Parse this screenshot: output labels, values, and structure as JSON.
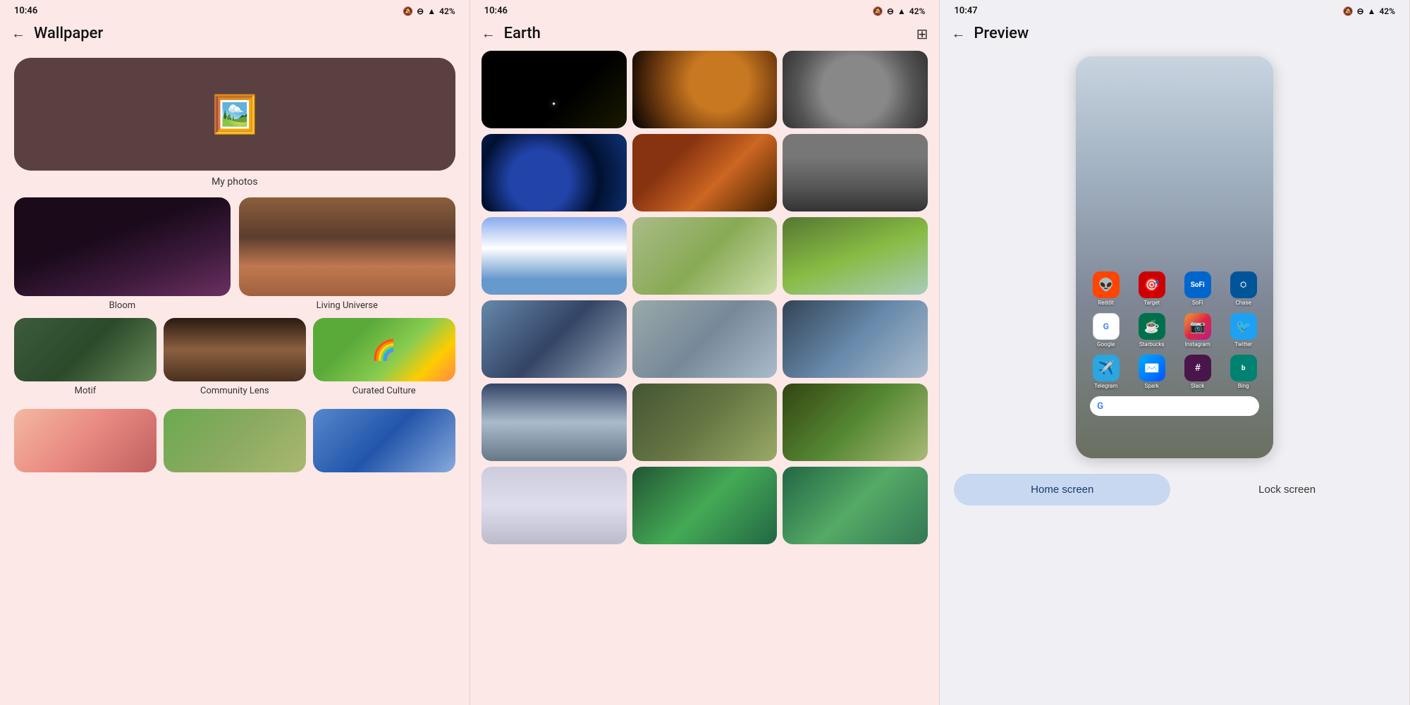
{
  "panel1": {
    "status": {
      "time": "10:46",
      "icons": "🔕 ⊖ ▲ 42%"
    },
    "title": "Wallpaper",
    "photos_label": "My photos",
    "categories": [
      {
        "name": "Bloom",
        "size": "large"
      },
      {
        "name": "Living Universe",
        "size": "large"
      },
      {
        "name": "Motif",
        "size": "small"
      },
      {
        "name": "Community Lens",
        "size": "small"
      },
      {
        "name": "Curated Culture",
        "size": "small"
      }
    ]
  },
  "panel2": {
    "status": {
      "time": "10:46",
      "icons": "🔕 ⊖ ▲ 42%"
    },
    "title": "Earth",
    "grid_count": 18
  },
  "panel3": {
    "status": {
      "time": "10:47",
      "icons": "🔕 ⊖ ▲ 42%"
    },
    "title": "Preview",
    "apps": {
      "row1": [
        {
          "label": "Reddit",
          "class": "ic-reddit"
        },
        {
          "label": "Target",
          "class": "ic-target"
        },
        {
          "label": "SoFi",
          "class": "ic-sofi"
        },
        {
          "label": "Chase",
          "class": "ic-chase"
        }
      ],
      "row2": [
        {
          "label": "Google",
          "class": "ic-google"
        },
        {
          "label": "Starbucks",
          "class": "ic-starbucks"
        },
        {
          "label": "Instagram",
          "class": "ic-instagram"
        },
        {
          "label": "Twitter",
          "class": "ic-twitter"
        }
      ],
      "row3": [
        {
          "label": "Telegram",
          "class": "ic-telegram"
        },
        {
          "label": "Spark",
          "class": "ic-spark"
        },
        {
          "label": "Slack",
          "class": "ic-slack"
        },
        {
          "label": "Bing",
          "class": "ic-bing"
        }
      ]
    },
    "buttons": {
      "home": "Home screen",
      "lock": "Lock screen"
    }
  }
}
